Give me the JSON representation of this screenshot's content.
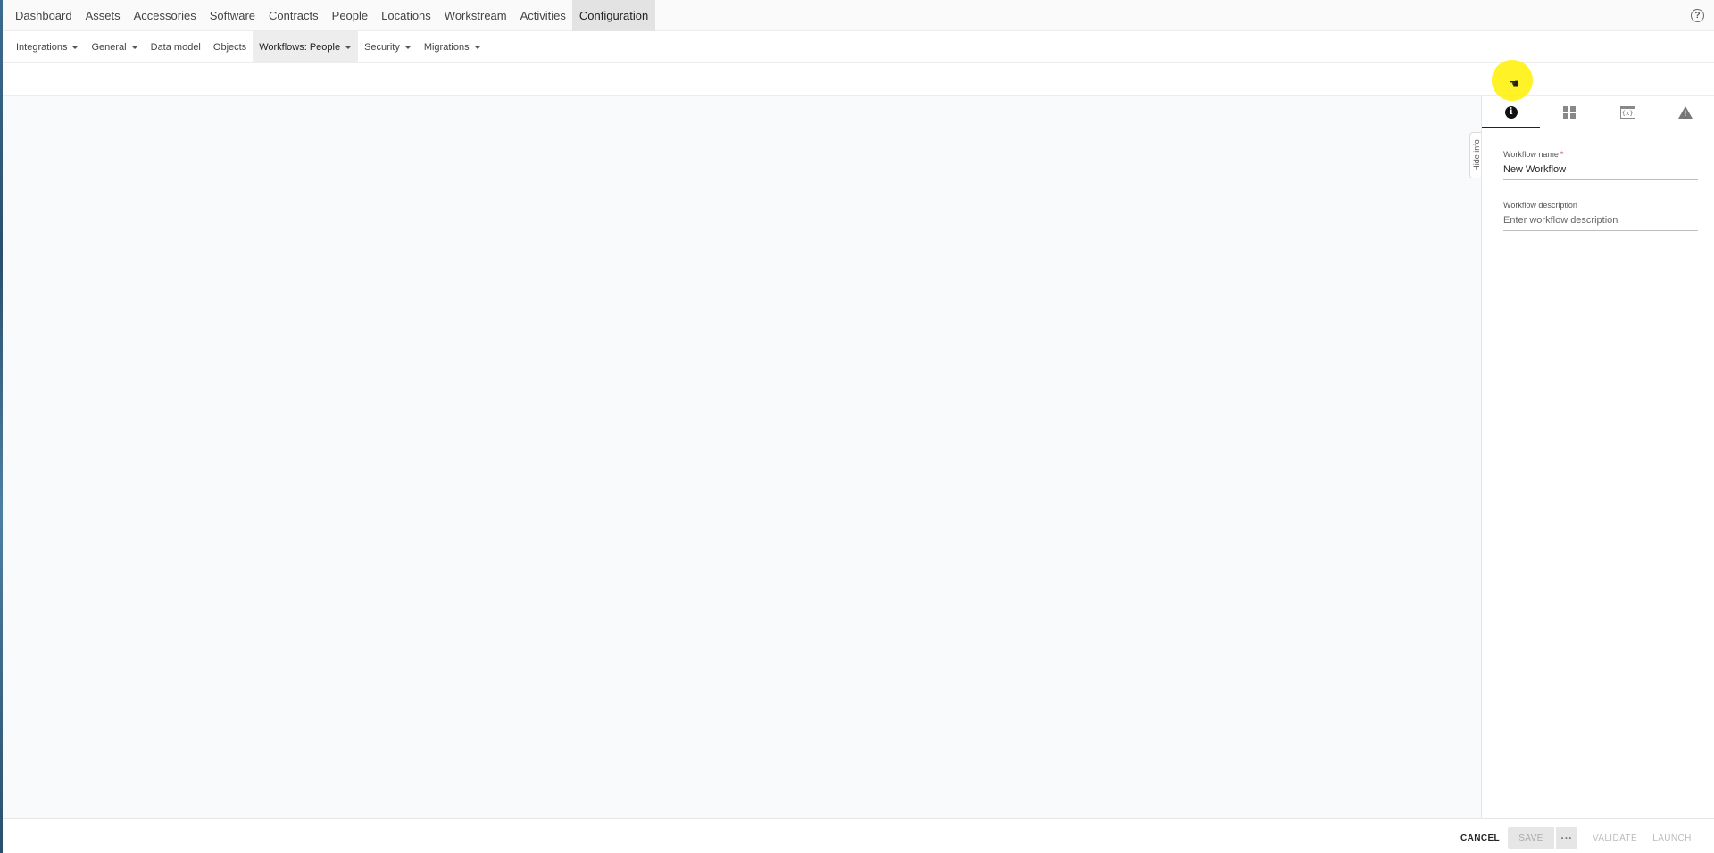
{
  "top_nav": {
    "items": [
      {
        "label": "Dashboard"
      },
      {
        "label": "Assets"
      },
      {
        "label": "Accessories"
      },
      {
        "label": "Software"
      },
      {
        "label": "Contracts"
      },
      {
        "label": "People"
      },
      {
        "label": "Locations"
      },
      {
        "label": "Workstream"
      },
      {
        "label": "Activities"
      },
      {
        "label": "Configuration",
        "active": true
      }
    ],
    "help_icon": "help-circle-icon"
  },
  "sub_nav": {
    "items": [
      {
        "label": "Integrations",
        "dropdown": true
      },
      {
        "label": "General",
        "dropdown": true
      },
      {
        "label": "Data model",
        "dropdown": false
      },
      {
        "label": "Objects",
        "dropdown": false
      },
      {
        "label": "Workflows: People",
        "dropdown": true,
        "active": true
      },
      {
        "label": "Security",
        "dropdown": true
      },
      {
        "label": "Migrations",
        "dropdown": true
      }
    ]
  },
  "side_panel": {
    "tabs": [
      {
        "icon": "info-icon",
        "active": true
      },
      {
        "icon": "grid-icon",
        "active": false
      },
      {
        "icon": "variables-icon",
        "glyph": "{x}",
        "active": false
      },
      {
        "icon": "warning-icon",
        "active": false
      }
    ],
    "hide_info_label": "Hide info",
    "workflow_name": {
      "label": "Workflow name",
      "required_mark": "*",
      "value": "New Workflow"
    },
    "workflow_description": {
      "label": "Workflow description",
      "placeholder": "Enter workflow description"
    }
  },
  "footer": {
    "cancel_label": "CANCEL",
    "save_label": "SAVE",
    "more_label": "···",
    "validate_label": "VALIDATE",
    "launch_label": "LAUNCH"
  },
  "colors": {
    "active_tab_bg": "#e3e3e3",
    "required": "#d32f2f",
    "cursor_highlight": "#fff000"
  }
}
